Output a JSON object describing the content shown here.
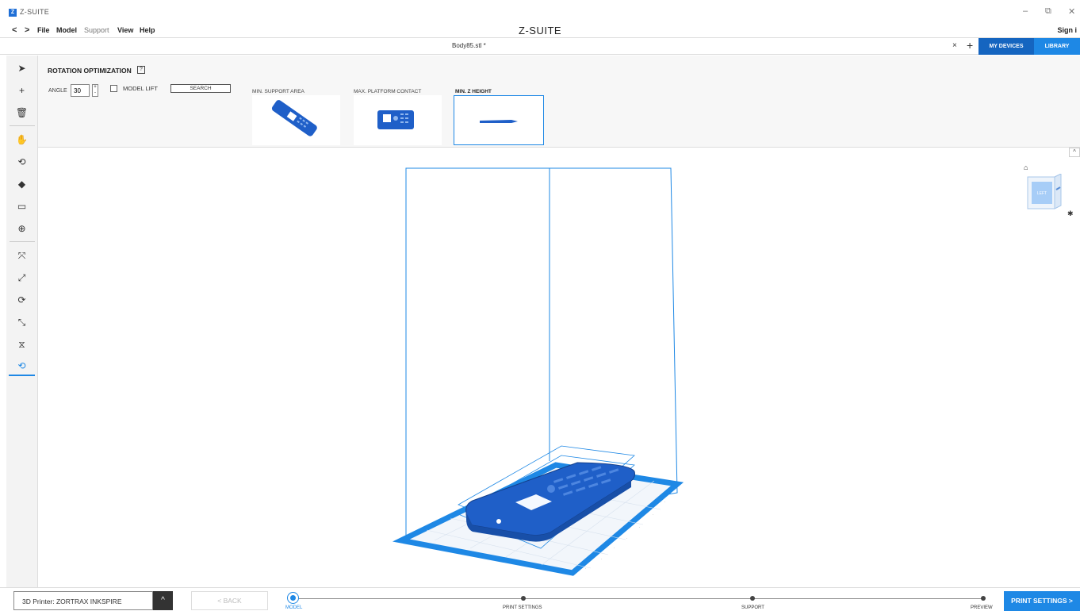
{
  "window": {
    "app_title": "Z-SUITE",
    "logo_letter": "Z",
    "minimize": "–",
    "restore": "⧉",
    "close": "✕"
  },
  "menu": {
    "back_arrow": "<",
    "forward_arrow": ">",
    "items": [
      "File",
      "Model",
      "Support",
      "View",
      "Help"
    ],
    "brand": "Z-SUITE",
    "sign_in": "Sign i"
  },
  "tabs": {
    "filename": "Body85.stl *",
    "close": "×",
    "add": "+",
    "my_devices": "MY DEVICES",
    "library": "LIBRARY"
  },
  "toolbar": {
    "tools": [
      {
        "name": "select-icon",
        "glyph": "➤"
      },
      {
        "name": "add-model-icon",
        "glyph": "+"
      },
      {
        "name": "delete-icon",
        "glyph": "🗑"
      },
      {
        "name": "pan-hand-icon",
        "glyph": "✋"
      },
      {
        "name": "rotate-view-icon",
        "glyph": "⟲"
      },
      {
        "name": "view-cube-icon",
        "glyph": "◆"
      },
      {
        "name": "camera-icon",
        "glyph": "▭"
      },
      {
        "name": "zoom-icon",
        "glyph": "⊕"
      },
      {
        "name": "move-axes-icon",
        "glyph": "⤧"
      },
      {
        "name": "scale-icon",
        "glyph": "⤢"
      },
      {
        "name": "rotate-model-icon",
        "glyph": "⟳"
      },
      {
        "name": "auto-arrange-icon",
        "glyph": "⤡"
      },
      {
        "name": "mirror-icon",
        "glyph": "⧖"
      },
      {
        "name": "rotation-optimization-icon",
        "glyph": "⟲"
      }
    ]
  },
  "panel": {
    "title": "ROTATION OPTIMIZATION",
    "help": "?",
    "angle_label": "ANGLE",
    "angle_value": "30",
    "spin_up": "+",
    "spin_down": "-",
    "model_lift_label": "MODEL LIFT",
    "model_lift_checked": false,
    "search_label": "SEARCH",
    "options": [
      {
        "label": "MIN. SUPPORT AREA",
        "selected": false
      },
      {
        "label": "MAX. PLATFORM CONTACT",
        "selected": false
      },
      {
        "label": "MIN. Z HEIGHT",
        "selected": true
      }
    ]
  },
  "viewport": {
    "collapse": "^",
    "view_cube_face": "LEFT",
    "home_icon": "⌂",
    "settings_icon": "✱"
  },
  "bottom": {
    "printer_label": "3D Printer: ZORTRAX INKSPIRE",
    "printer_toggle": "^",
    "back_label": "< BACK",
    "steps": [
      "MODEL",
      "PRINT SETTINGS",
      "SUPPORT",
      "PREVIEW"
    ],
    "active_step": "MODEL",
    "next_label": "PRINT SETTINGS >"
  },
  "colors": {
    "accent": "#1e88e5",
    "model": "#1f5fc8"
  }
}
